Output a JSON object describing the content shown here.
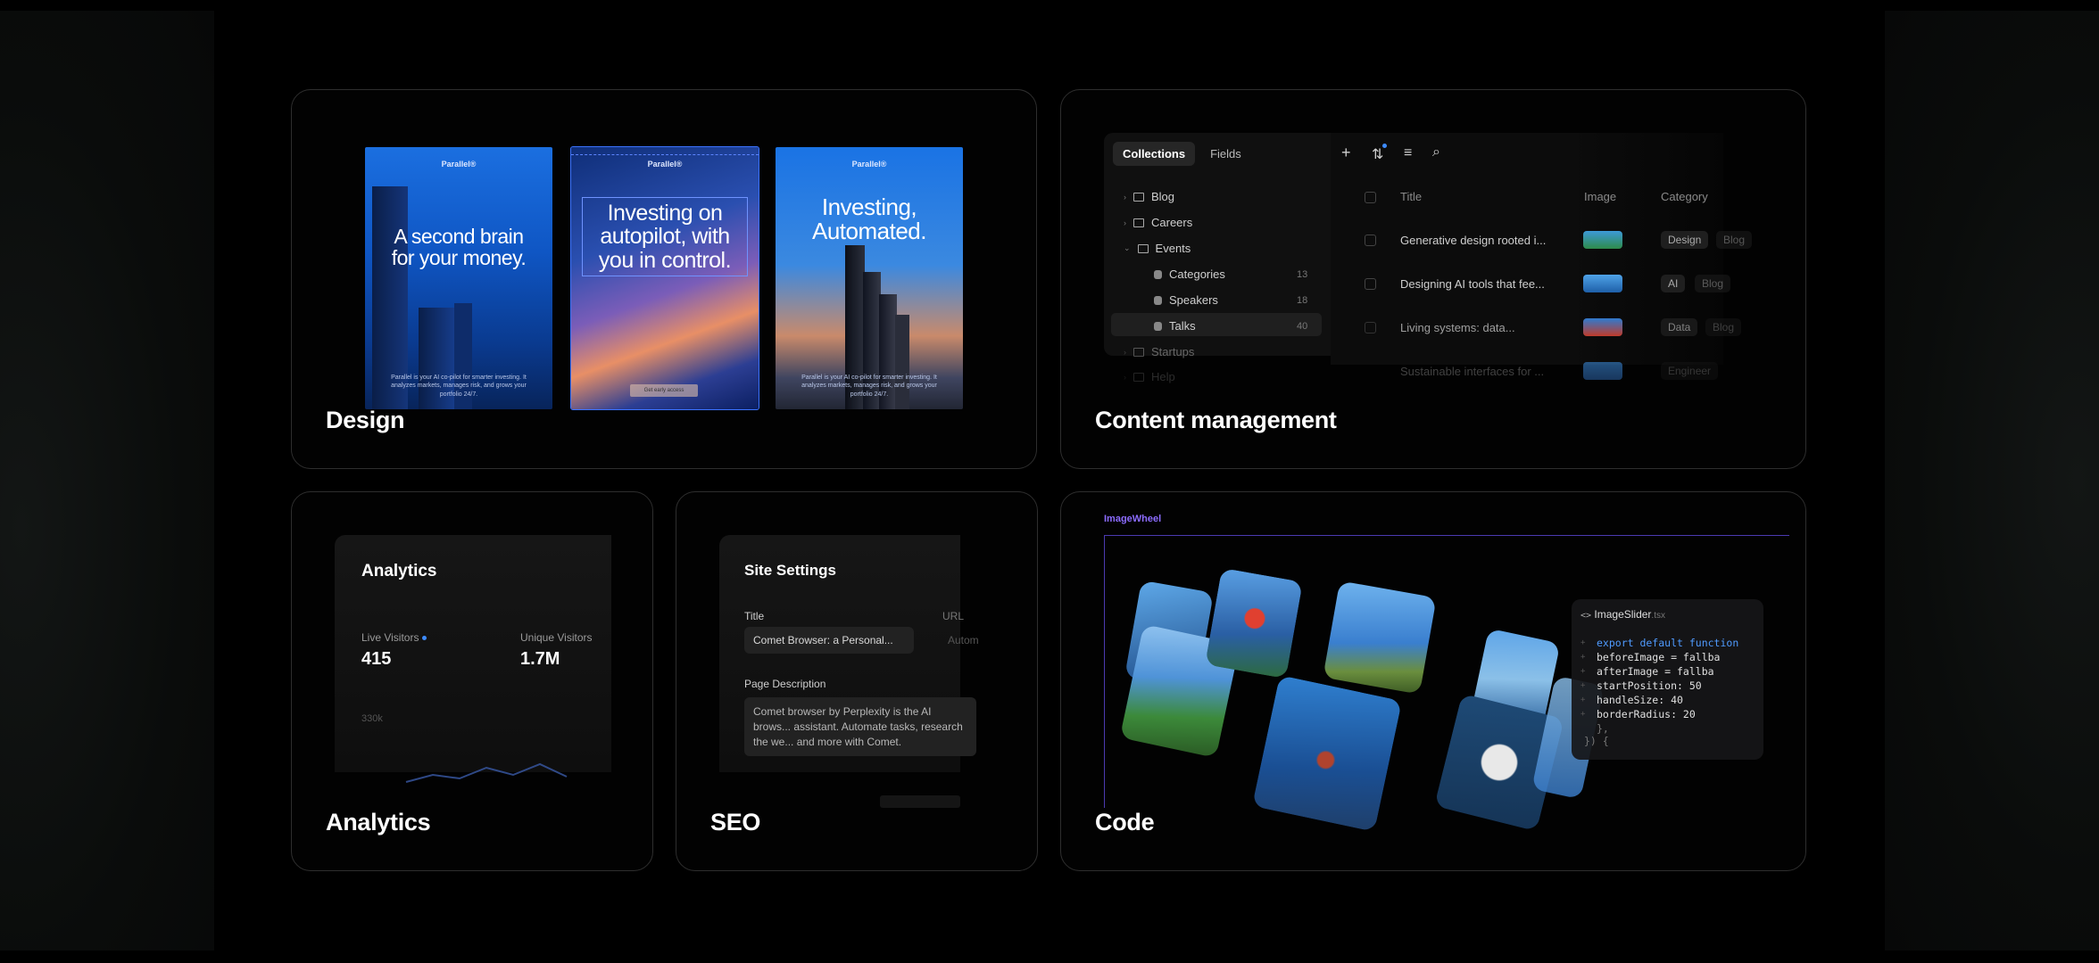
{
  "cards": {
    "design": {
      "title": "Design",
      "posters": [
        {
          "brand": "Parallel®",
          "headline": "A second brain for your money.",
          "blurb": "Parallel is your AI co-pilot for smarter investing. It analyzes markets, manages risk, and grows your portfolio 24/7."
        },
        {
          "brand": "Parallel®",
          "headline": "Investing on autopilot, with you in control.",
          "button": "Get early access"
        },
        {
          "brand": "Parallel®",
          "headline": "Investing, Automated.",
          "blurb": "Parallel is your AI co-pilot for smarter investing. It analyzes markets, manages risk, and grows your portfolio 24/7."
        }
      ]
    },
    "content": {
      "title": "Content management",
      "tabs": [
        "Collections",
        "Fields"
      ],
      "tree": [
        {
          "label": "Blog"
        },
        {
          "label": "Careers"
        },
        {
          "label": "Events"
        },
        {
          "label": "Categories",
          "count": "13"
        },
        {
          "label": "Speakers",
          "count": "18"
        },
        {
          "label": "Talks",
          "count": "40"
        },
        {
          "label": "Startups"
        },
        {
          "label": "Help"
        }
      ],
      "columns": [
        "Title",
        "Image",
        "Category"
      ],
      "rows": [
        {
          "title": "Generative design rooted i...",
          "tags": [
            "Design",
            "Blog"
          ]
        },
        {
          "title": "Designing AI tools that fee...",
          "tags": [
            "AI",
            "Blog"
          ]
        },
        {
          "title": "Living systems: data...",
          "tags": [
            "Data",
            "Blog"
          ]
        },
        {
          "title": "Sustainable interfaces for ...",
          "tags": [
            "Engineer"
          ]
        }
      ]
    },
    "analytics": {
      "title": "Analytics",
      "panel_title": "Analytics",
      "live_label": "Live Visitors",
      "live_value": "415",
      "unique_label": "Unique Visitors",
      "unique_value": "1.7M",
      "axis_tick": "330k"
    },
    "seo": {
      "title": "SEO",
      "panel_title": "Site Settings",
      "title_label": "Title",
      "title_value": "Comet Browser: a Personal...",
      "url_label": "URL",
      "url_value": "Autom",
      "desc_label": "Page Description",
      "desc_value": "Comet browser by Perplexity is the AI brows... assistant. Automate tasks, research the we... and more with Comet."
    },
    "code": {
      "title": "Code",
      "component_label": "ImageWheel",
      "file_name": "ImageSlider",
      "file_ext": ".tsx",
      "code_lines": [
        "export default function",
        "  beforeImage = fallba",
        "  afterImage = fallba",
        "  startPosition: 50",
        "  handleSize: 40",
        "  borderRadius: 20",
        "},",
        "}) {"
      ]
    }
  },
  "colors": {
    "accent": "#3d8bff",
    "purple": "#8c6cff",
    "border": "#2e2e2e"
  }
}
